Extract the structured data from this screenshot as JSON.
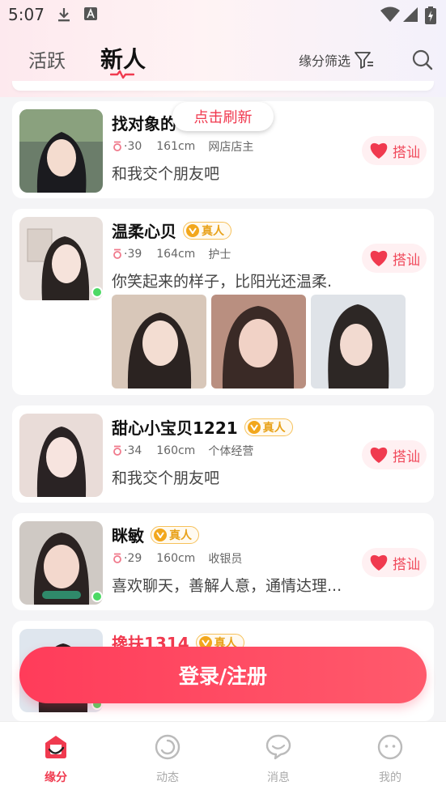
{
  "status_bar": {
    "time": "5:07"
  },
  "header": {
    "tabs": [
      {
        "label": "活跃"
      },
      {
        "label": "新人"
      }
    ],
    "filter_label": "缘分筛选"
  },
  "refresh_label": "点击刷新",
  "users": [
    {
      "name": "找对象的",
      "verified": false,
      "age": "·30",
      "height": "161cm",
      "job": "网店店主",
      "bio": "和我交个朋友吧",
      "online": false,
      "chat_label": "搭讪",
      "photos": 0
    },
    {
      "name": "温柔心贝",
      "verified": true,
      "badge": "真人",
      "age": "·39",
      "height": "164cm",
      "job": "护士",
      "bio": "你笑起来的样子，比阳光还温柔.",
      "online": true,
      "chat_label": "搭讪",
      "photos": 3
    },
    {
      "name": "甜心小宝贝1221",
      "verified": true,
      "badge": "真人",
      "age": "·34",
      "height": "160cm",
      "job": "个体经营",
      "bio": "和我交个朋友吧",
      "online": false,
      "chat_label": "搭讪",
      "photos": 0
    },
    {
      "name": "眯敏",
      "verified": true,
      "badge": "真人",
      "age": "·29",
      "height": "160cm",
      "job": "收银员",
      "bio": "喜欢聊天，善解人意，通情达理...",
      "online": true,
      "chat_label": "搭讪",
      "photos": 0
    },
    {
      "name": "搀扶1314",
      "verified": true,
      "badge": "真人",
      "online": true
    }
  ],
  "login_button": "登录/注册",
  "bottom_nav": [
    {
      "label": "缘分",
      "icon": "home-heart-icon"
    },
    {
      "label": "动态",
      "icon": "moments-icon"
    },
    {
      "label": "消息",
      "icon": "message-icon"
    },
    {
      "label": "我的",
      "icon": "profile-icon"
    }
  ],
  "colors": {
    "accent": "#f03a4f",
    "badge": "#f2a71c",
    "online": "#4cd964"
  }
}
